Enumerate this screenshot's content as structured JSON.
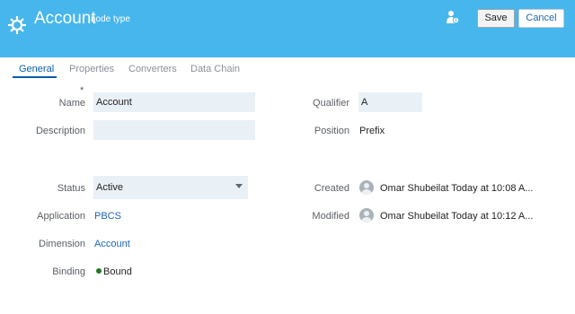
{
  "header": {
    "title": "Account",
    "subtitle": "node type",
    "save_label": "Save",
    "cancel_label": "Cancel",
    "icons": {
      "node": "gear-icon",
      "user": "user-info-icon"
    },
    "bg_color": "#47b6ec"
  },
  "tabs": [
    {
      "label": "General",
      "active": true
    },
    {
      "label": "Properties",
      "active": false
    },
    {
      "label": "Converters",
      "active": false
    },
    {
      "label": "Data Chain",
      "active": false
    }
  ],
  "form": {
    "required_mark": "*",
    "name": {
      "label": "Name",
      "value": "Account"
    },
    "description": {
      "label": "Description",
      "value": ""
    },
    "status": {
      "label": "Status",
      "value": "Active"
    },
    "application": {
      "label": "Application",
      "value": "PBCS"
    },
    "dimension": {
      "label": "Dimension",
      "value": "Account"
    },
    "binding": {
      "label": "Binding",
      "value": "Bound",
      "status_color": "#1f7a1f"
    },
    "qualifier": {
      "label": "Qualifier",
      "value": "A"
    },
    "position": {
      "label": "Position",
      "value": "Prefix"
    },
    "created": {
      "label": "Created",
      "value": "Omar Shubeilat Today at 10:08 A..."
    },
    "modified": {
      "label": "Modified",
      "value": "Omar Shubeilat Today at 10:12 A..."
    }
  }
}
